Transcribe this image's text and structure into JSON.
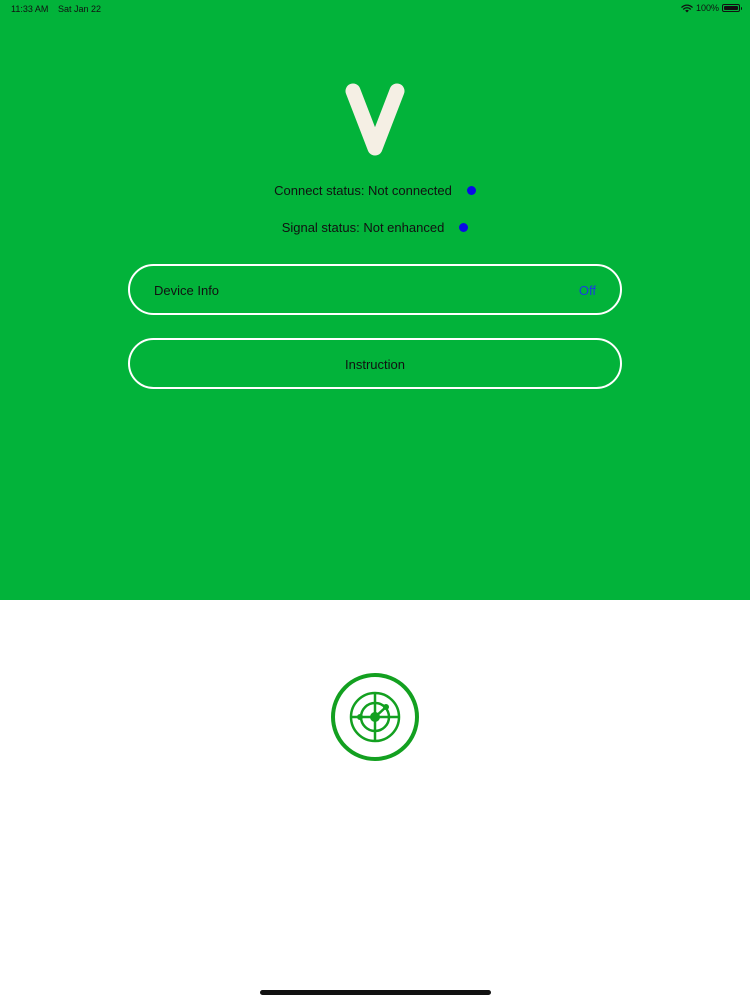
{
  "status_bar": {
    "time": "11:33 AM",
    "date": "Sat Jan 22",
    "battery": "100%",
    "battery_level": 1.0,
    "icons": [
      "wifi-icon",
      "battery-icon"
    ]
  },
  "header": {
    "logo_letter": "V",
    "logo_color": "#f5efe4"
  },
  "status": {
    "connect_text": "Connect status: Not connected",
    "signal_text": "Signal status: Not enhanced",
    "dot_color": "#0a0ae6"
  },
  "device_info": {
    "label": "Device Info",
    "value": "Off",
    "value_color": "#1b3de0"
  },
  "instruction": {
    "label": "Instruction"
  },
  "scan": {
    "icon": "radar-icon",
    "color": "#13a020"
  },
  "colors": {
    "panel_bg": "#02b33a",
    "page_bg": "#ffffff"
  }
}
